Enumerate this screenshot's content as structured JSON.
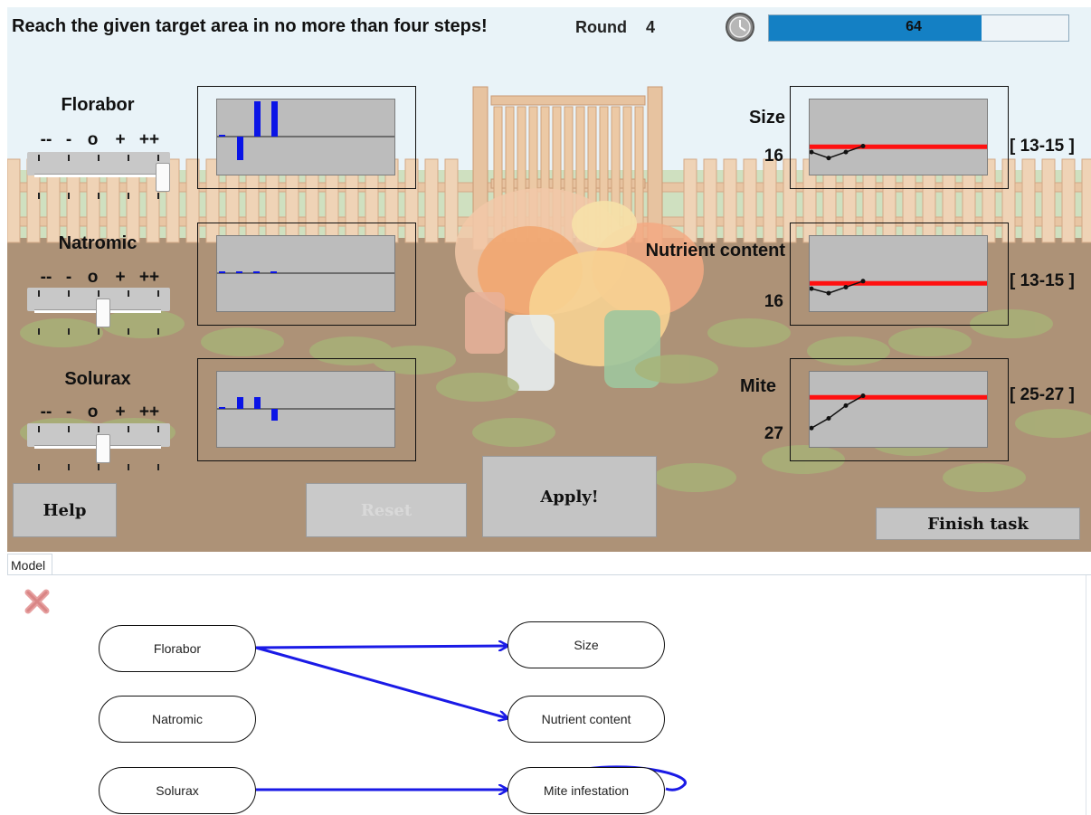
{
  "task": {
    "instruction": "Reach the given target area in no more than four steps!",
    "round_label": "Round",
    "round_value": "4"
  },
  "timer": {
    "icon": "clock-icon",
    "value": "64",
    "fill_fraction": 0.71,
    "color": "#1480c4"
  },
  "scale_marks": [
    "--",
    "-",
    "o",
    "+",
    "++"
  ],
  "inputs": [
    {
      "label": "Florabor",
      "slider_level": "++",
      "history": [
        -1,
        -2,
        3,
        3
      ]
    },
    {
      "label": "Natromic",
      "slider_level": "o",
      "history": [
        0,
        0,
        0,
        0
      ]
    },
    {
      "label": "Solurax",
      "slider_level": "o",
      "history": [
        -1,
        1,
        1,
        -1
      ]
    }
  ],
  "outputs": [
    {
      "label": "Size",
      "value": "16",
      "target": "[ 13-15 ]"
    },
    {
      "label": "Nutrient content",
      "value": "16",
      "target": "[ 13-15 ]"
    },
    {
      "label": "Mite",
      "value": "27",
      "target": "[ 25-27 ]"
    }
  ],
  "buttons": {
    "help": "Help",
    "reset": "Reset",
    "apply": "Apply!",
    "finish": "Finish task"
  },
  "model": {
    "tab_label": "Model",
    "delete_icon": "close-icon",
    "inputs": [
      "Florabor",
      "Natromic",
      "Solurax"
    ],
    "outputs": [
      "Size",
      "Nutrient content",
      "Mite infestation"
    ],
    "edges": [
      {
        "from": "Florabor",
        "to": "Size"
      },
      {
        "from": "Florabor",
        "to": "Nutrient content"
      },
      {
        "from": "Solurax",
        "to": "Mite infestation"
      },
      {
        "from": "Mite infestation",
        "to": "Mite infestation"
      }
    ]
  },
  "colors": {
    "edge": "#1a1ae6",
    "bar": "#0a14e6",
    "target_line": "#ff1010",
    "panel_bg": "#bcbcbc"
  }
}
